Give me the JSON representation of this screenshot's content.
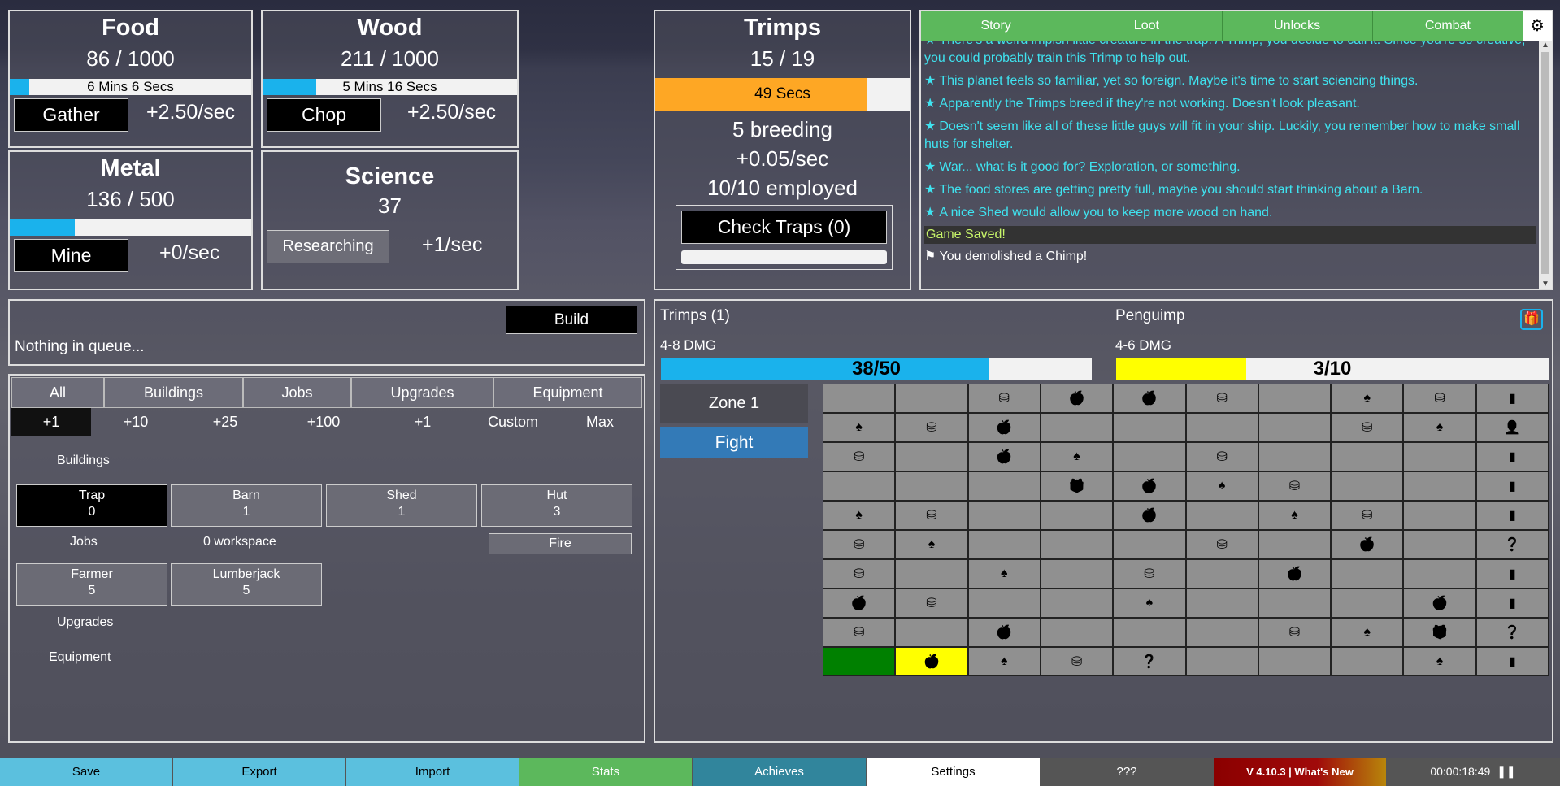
{
  "food": {
    "title": "Food",
    "amount": "86 / 1000",
    "timer": "6 Mins 6 Secs",
    "fill": 0.08,
    "button": "Gather",
    "rate": "+2.50/sec"
  },
  "wood": {
    "title": "Wood",
    "amount": "211 / 1000",
    "timer": "5 Mins 16 Secs",
    "fill": 0.21,
    "button": "Chop",
    "rate": "+2.50/sec"
  },
  "metal": {
    "title": "Metal",
    "amount": "136 / 500",
    "fill": 0.27,
    "button": "Mine",
    "rate": "+0/sec"
  },
  "science": {
    "title": "Science",
    "amount": "37",
    "button": "Researching",
    "rate": "+1/sec"
  },
  "trimps": {
    "title": "Trimps",
    "amount": "15 / 19",
    "timer": "49 Secs",
    "fill": 0.83,
    "breeding": "5 breeding",
    "rate": "+0.05/sec",
    "employed": "10/10 employed",
    "check_traps": "Check Traps (0)"
  },
  "log": {
    "tabs": [
      "Story",
      "Loot",
      "Unlocks",
      "Combat"
    ],
    "settings_icon": "gear-icon",
    "messages": [
      "There's a weird impish little creature in the trap. A Trimp, you decide to call it. Since you're so creative, you could probably train this Trimp to help out.",
      "This planet feels so familiar, yet so foreign. Maybe it's time to start sciencing things.",
      "Apparently the Trimps breed if they're not working. Doesn't look pleasant.",
      "Doesn't seem like all of these little guys will fit in your ship. Luckily, you remember how to make small huts for shelter.",
      "War... what is it good for? Exploration, or something.",
      "The food stores are getting pretty full, maybe you should start thinking about a Barn.",
      "A nice Shed would allow you to keep more wood on hand."
    ],
    "saved": "Game Saved!",
    "demolished": "You demolished a Chimp!"
  },
  "queue": {
    "build": "Build",
    "empty": "Nothing in queue..."
  },
  "tabs": {
    "filters": [
      "All",
      "Buildings",
      "Jobs",
      "Upgrades",
      "Equipment"
    ],
    "amounts": [
      "+1",
      "+10",
      "+25",
      "+100",
      "+1",
      "Custom",
      "Max"
    ]
  },
  "buildings": {
    "label": "Buildings",
    "items": [
      {
        "name": "Trap",
        "count": "0"
      },
      {
        "name": "Barn",
        "count": "1"
      },
      {
        "name": "Shed",
        "count": "1"
      },
      {
        "name": "Hut",
        "count": "3"
      }
    ]
  },
  "jobs": {
    "label": "Jobs",
    "workspace": "0 workspace",
    "fire": "Fire",
    "items": [
      {
        "name": "Farmer",
        "count": "5"
      },
      {
        "name": "Lumberjack",
        "count": "5"
      }
    ]
  },
  "upgrades_label": "Upgrades",
  "equipment_label": "Equipment",
  "battle": {
    "player_name": "Trimps (1)",
    "player_dmg": "4-8 DMG",
    "player_health": "38/50",
    "player_fill": 0.76,
    "enemy_name": "Penguimp",
    "enemy_dmg": "4-6 DMG",
    "enemy_health": "3/10",
    "enemy_fill": 0.3,
    "zone": "Zone 1",
    "fight": "Fight",
    "gift_icon": "gift-icon"
  },
  "map": [
    [
      "",
      "",
      "wood",
      "food",
      "food",
      "wood",
      "",
      "tree",
      "wood",
      "book"
    ],
    [
      "tree",
      "wood",
      "food",
      "",
      "",
      "",
      "",
      "wood",
      "tree",
      "person"
    ],
    [
      "wood",
      "",
      "food",
      "tree",
      "",
      "wood",
      "",
      "",
      "",
      "book"
    ],
    [
      "",
      "",
      "",
      "gift",
      "food",
      "tree",
      "wood",
      "",
      "",
      "book"
    ],
    [
      "tree",
      "wood",
      "",
      "",
      "food",
      "",
      "tree",
      "wood",
      "",
      "book"
    ],
    [
      "wood",
      "tree",
      "",
      "",
      "",
      "wood",
      "",
      "food",
      "",
      "question"
    ],
    [
      "wood",
      "",
      "tree",
      "",
      "wood",
      "",
      "food",
      "",
      "",
      "book"
    ],
    [
      "food",
      "wood",
      "",
      "",
      "tree",
      "",
      "",
      "",
      "food",
      "book"
    ],
    [
      "wood",
      "",
      "food",
      "",
      "",
      "",
      "wood",
      "tree",
      "gift",
      "question"
    ],
    [
      "cleared",
      "current-food",
      "tree",
      "wood",
      "question",
      "",
      "",
      "",
      "tree",
      "book"
    ]
  ],
  "footer": {
    "save": "Save",
    "export": "Export",
    "import": "Import",
    "stats": "Stats",
    "achieves": "Achieves",
    "settings": "Settings",
    "unknown": "???",
    "version": "V 4.10.3 | What's New",
    "time": "00:00:18:49"
  },
  "colors": {
    "accent_blue": "#1ab2ec",
    "trimp_orange": "#fea724",
    "enemy_yellow": "#ffff00",
    "log_green": "#5cb85c",
    "fight_blue": "#337ab7",
    "log_text": "#3fe3f0"
  }
}
